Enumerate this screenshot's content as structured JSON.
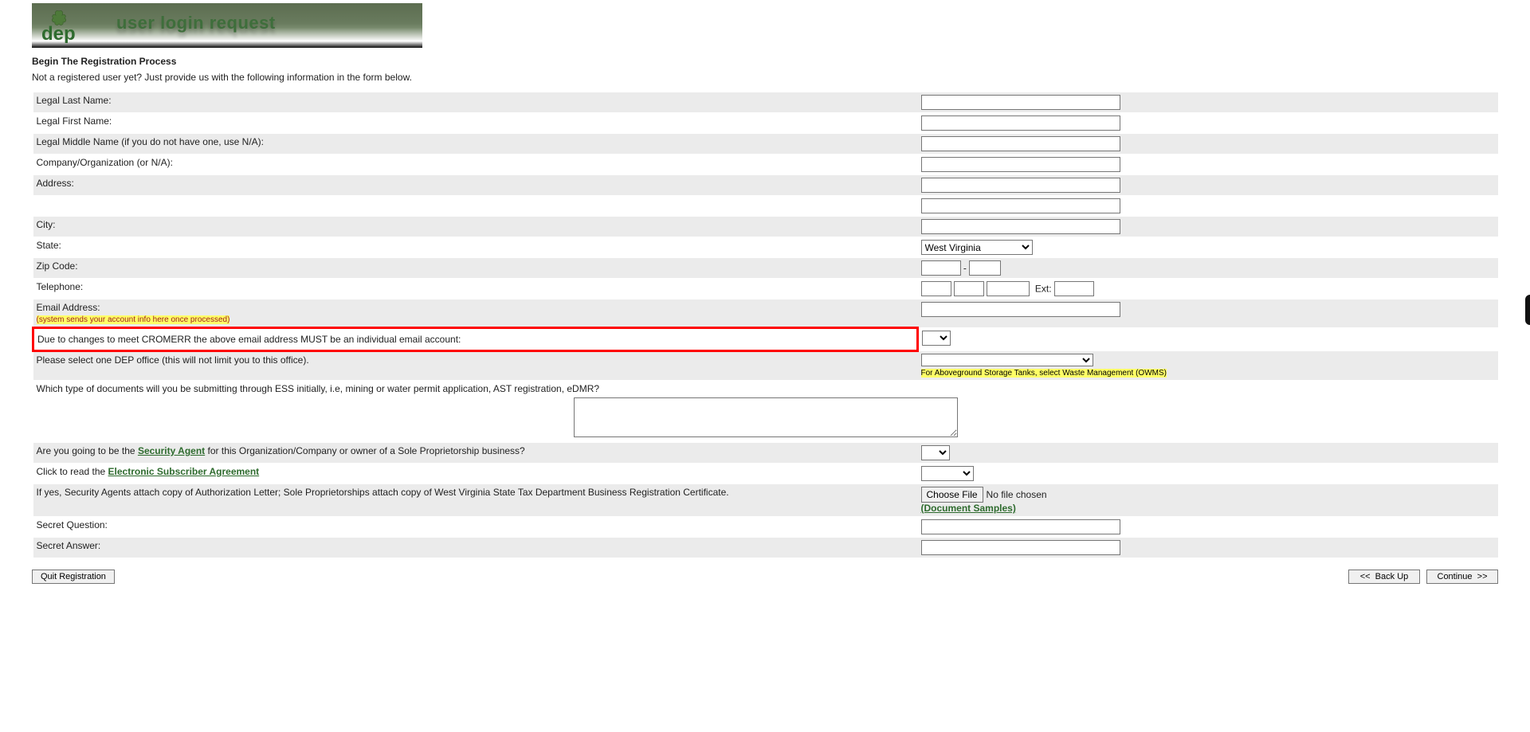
{
  "banner": {
    "title": "user login request"
  },
  "intro": {
    "heading": "Begin The Registration Process",
    "subtext": "Not a registered user yet? Just provide us with the following information in the form below."
  },
  "labels": {
    "last_name": "Legal Last Name:",
    "first_name": "Legal First Name:",
    "middle_name": "Legal Middle Name (if you do not have one, use N/A):",
    "company": "Company/Organization (or N/A):",
    "address": "Address:",
    "address2": "",
    "city": "City:",
    "state": "State:",
    "zip": "Zip Code:",
    "telephone": "Telephone:",
    "ext": "Ext:",
    "email": "Email Address:",
    "email_note": "(system sends your account info here once processed)",
    "cromerr": "Due to changes to meet CROMERR the above email address MUST be an individual email account:",
    "dep_office": "Please select one DEP office (this will not limit you to this office).",
    "ast_note": "For Aboveground Storage Tanks, select Waste Management (OWMS)",
    "doc_types": "Which type of documents will you be submitting through ESS initially, i.e, mining or water permit application, AST registration, eDMR?",
    "security_pre": "Are you going to be the ",
    "security_link": "Security Agent",
    "security_post": " for this Organization/Company or owner of a Sole Proprietorship business?",
    "esa_pre": "Click to read the ",
    "esa_link": "Electronic Subscriber Agreement",
    "auth_letter": "If yes, Security Agents attach copy of Authorization Letter; Sole Proprietorships attach copy of West Virginia State Tax Department Business Registration Certificate.",
    "choose_file": "Choose File",
    "no_file": "No file chosen",
    "doc_samples": "(Document Samples)",
    "secret_q": "Secret Question:",
    "secret_a": "Secret Answer:"
  },
  "values": {
    "state_selected": "West Virginia",
    "zip_sep": " - "
  },
  "buttons": {
    "quit": "Quit Registration",
    "back": "<<  Back Up",
    "continue": "Continue  >>"
  }
}
